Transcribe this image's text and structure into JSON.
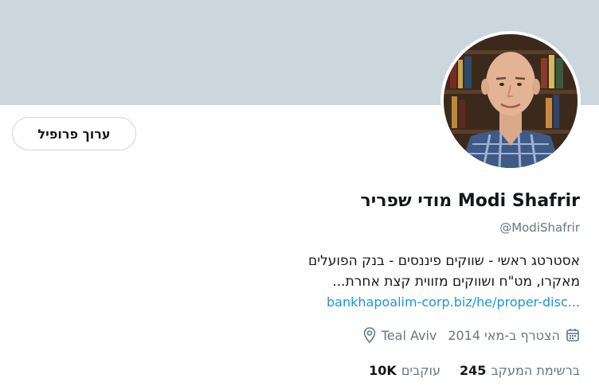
{
  "profile": {
    "display_name": "Modi Shafrir מודי שפריר",
    "handle": "@ModiShafrir",
    "edit_button_label": "ערוך פרופיל",
    "bio_line1": "אסטרטג ראשי - שווקים פיננסים - בנק הפועלים",
    "bio_line2": "מאקרו, מט\"ח ושווקים מזווית קצת אחרת...",
    "bio_link": "bankhapoalim-corp.biz/he/proper-disc...",
    "joined": "הצטרף ב-מאי 2014",
    "location": "Teal Aviv",
    "following_count": "245",
    "following_label": "ברשימת המעקב",
    "followers_count": "10K",
    "followers_label": "עוקבים"
  },
  "colors": {
    "banner": "#ccd6dd",
    "link": "#1b95e0",
    "secondary_text": "#657786"
  },
  "icons": {
    "location": "location-pin-icon",
    "calendar": "calendar-icon"
  }
}
